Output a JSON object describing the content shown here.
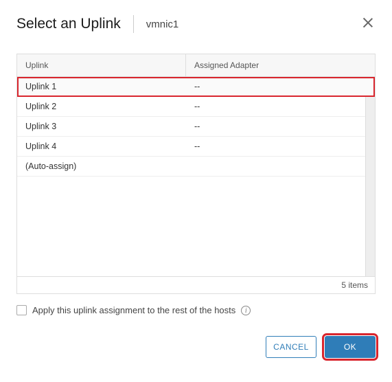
{
  "header": {
    "title": "Select an Uplink",
    "subtitle": "vmnic1"
  },
  "table": {
    "columns": {
      "uplink": "Uplink",
      "adapter": "Assigned Adapter"
    },
    "rows": [
      {
        "uplink": "Uplink 1",
        "adapter": "--",
        "selected": true
      },
      {
        "uplink": "Uplink 2",
        "adapter": "--",
        "selected": false
      },
      {
        "uplink": "Uplink 3",
        "adapter": "--",
        "selected": false
      },
      {
        "uplink": "Uplink 4",
        "adapter": "--",
        "selected": false
      },
      {
        "uplink": "(Auto-assign)",
        "adapter": "",
        "selected": false
      }
    ],
    "footer": "5 items"
  },
  "apply": {
    "label": "Apply this uplink assignment to the rest of the hosts",
    "checked": false
  },
  "buttons": {
    "cancel": "CANCEL",
    "ok": "OK"
  }
}
